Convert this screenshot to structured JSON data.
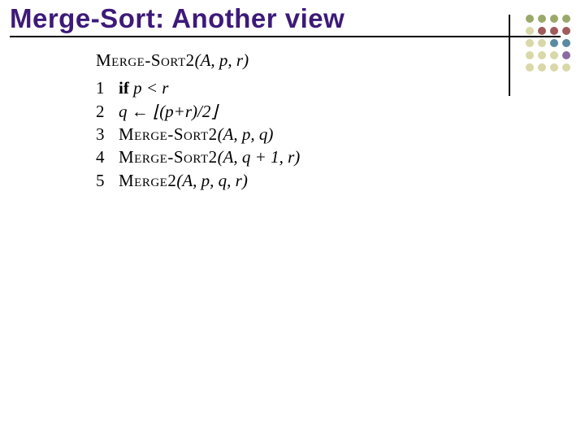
{
  "title": "Merge-Sort: Another view",
  "dots": {
    "rows": [
      [
        "#9aa96a",
        "#9aa96a",
        "#9aa96a",
        "#9aa96a"
      ],
      [
        "#d8d8a8",
        "#a05a5a",
        "#a05a5a",
        "#a05a5a"
      ],
      [
        "#d8d8a8",
        "#d8d8a8",
        "#5a8aa0",
        "#5a8aa0"
      ],
      [
        "#d8d8a8",
        "#d8d8a8",
        "#d8d8a8",
        "#8a6aa0"
      ],
      [
        "#d8d8a8",
        "#d8d8a8",
        "#d8d8a8",
        "#d8d8a8"
      ]
    ]
  },
  "algo": {
    "name": "Merge-Sort2",
    "call_name": "Merge2",
    "sig_args": "(A, p, r)",
    "lines": [
      {
        "n": "1",
        "indent": 1,
        "kw": "if",
        "rest": "  p < r"
      },
      {
        "n": "2",
        "indent": 2,
        "text": "q ← ⌊(p+r)/2⌋"
      },
      {
        "n": "3",
        "indent": 2,
        "sc": "Merge-Sort2",
        "args": "(A, p, q)"
      },
      {
        "n": "4",
        "indent": 2,
        "sc": "Merge-Sort2",
        "args": "(A, q + 1, r)"
      },
      {
        "n": "5",
        "indent": 2,
        "sc": "Merge2",
        "args": "(A, p, q, r)"
      }
    ]
  }
}
